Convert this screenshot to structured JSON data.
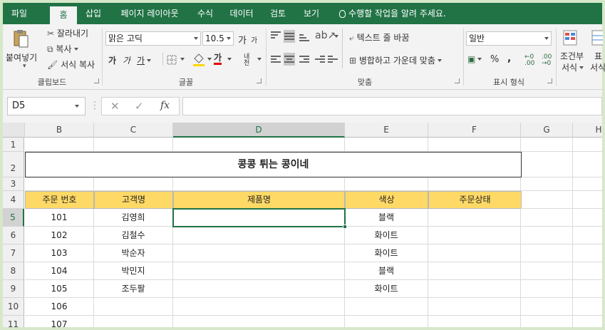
{
  "ribbon_tabs": [
    "파일",
    "홈",
    "삽입",
    "페이지 레이아웃",
    "수식",
    "데이터",
    "검토",
    "보기"
  ],
  "tell_me": "수행할 작업을 알려 주세요.",
  "clipboard": {
    "paste": "붙여넣기",
    "cut": "잘라내기",
    "copy": "복사",
    "format_painter": "서식 복사",
    "label": "클립보드"
  },
  "font": {
    "name": "맑은 고딕",
    "size": "10.5",
    "grow": "가",
    "shrink": "가",
    "bold": "가",
    "italic": "가",
    "underline": "가",
    "color_sample": "가",
    "phonetic": "내천",
    "label": "글꼴"
  },
  "alignment": {
    "wrap_text": "텍스트 줄 바꿈",
    "merge_center": "병합하고 가운데 맞춤",
    "label": "맞춤"
  },
  "number": {
    "format": "일반",
    "percent": "%",
    "comma": ",",
    "label": "표시 형식"
  },
  "styles": {
    "conditional_1": "조건부",
    "conditional_2": "서식",
    "partial_1": "표",
    "partial_2": "서식"
  },
  "formula_bar": {
    "name_box": "D5",
    "formula": ""
  },
  "columns": [
    "B",
    "C",
    "D",
    "E",
    "F",
    "G",
    "H"
  ],
  "rows": [
    "1",
    "2",
    "3",
    "4",
    "5",
    "6",
    "7",
    "8",
    "9",
    "10",
    "11"
  ],
  "sheet": {
    "title": "콩콩 튀는 콩이네",
    "headers": [
      "주문 번호",
      "고객명",
      "제품명",
      "색상",
      "주문상태"
    ],
    "rows": [
      [
        "101",
        "김영희",
        "",
        "블랙",
        ""
      ],
      [
        "102",
        "김철수",
        "",
        "화이트",
        ""
      ],
      [
        "103",
        "박순자",
        "",
        "화이트",
        ""
      ],
      [
        "104",
        "박민지",
        "",
        "블랙",
        ""
      ],
      [
        "105",
        "조두팔",
        "",
        "화이트",
        ""
      ],
      [
        "106",
        "",
        "",
        "",
        ""
      ],
      [
        "107",
        "",
        "",
        "",
        ""
      ]
    ]
  },
  "colors": {
    "excel_green": "#217346",
    "header_fill": "#ffd966",
    "frame": "#d6e8c9"
  }
}
